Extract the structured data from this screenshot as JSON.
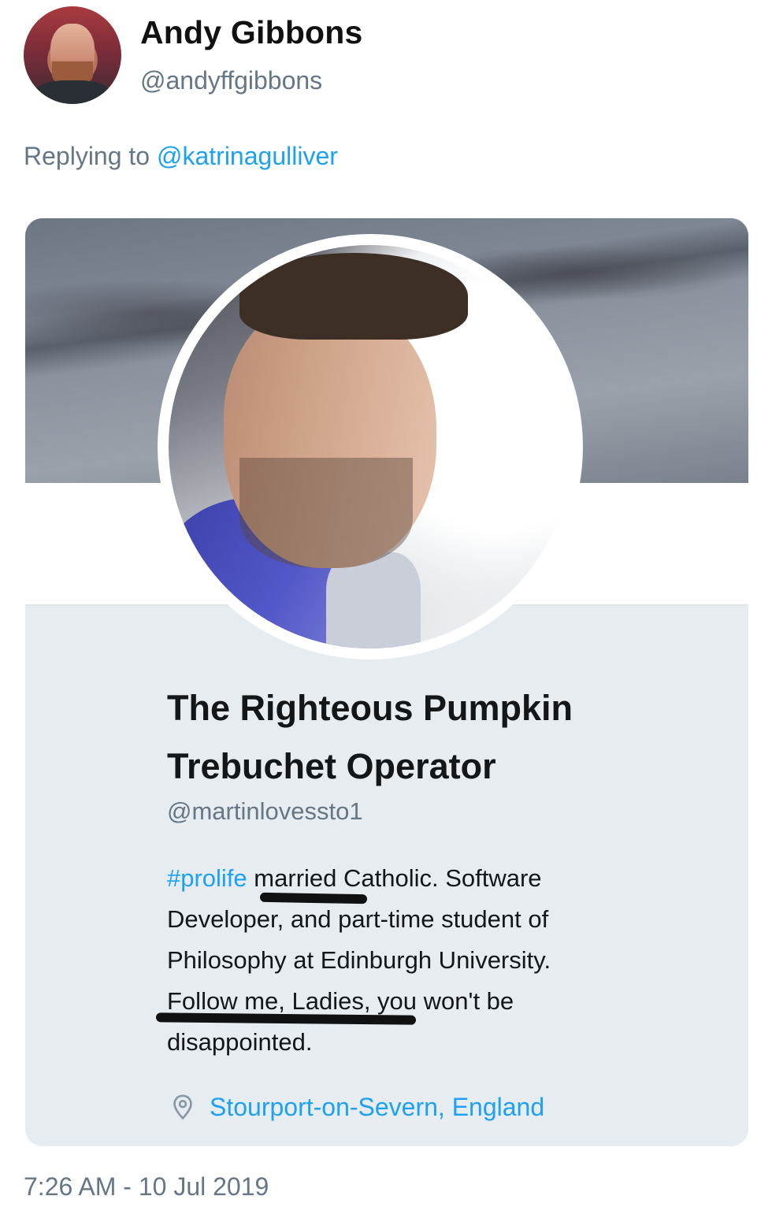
{
  "tweet": {
    "author": {
      "name": "Andy Gibbons",
      "handle": "@andyffgibbons"
    },
    "replying": {
      "prefix": "Replying to ",
      "mention": "@katrinagulliver"
    },
    "timestamp": "7:26 AM - 10 Jul 2019"
  },
  "profile_card": {
    "display_name_line1": "The Righteous Pumpkin",
    "display_name_line2": "Trebuchet Operator",
    "handle": "@martinlovessto1",
    "bio": {
      "hashtag": "#prolife",
      "line1_rest": " married Catholic. Software",
      "line2": "Developer, and part-time student of",
      "line3": "Philosophy at Edinburgh University.",
      "line4": "Follow me, Ladies, you won't be",
      "line5": "disappointed."
    },
    "location": "Stourport-on-Severn, England",
    "location_icon": "location-pin-icon"
  },
  "colors": {
    "link_blue": "#1da1f2",
    "secondary_gray": "#657786",
    "card_background": "#e6ecf0",
    "text_dark": "#14171a"
  }
}
